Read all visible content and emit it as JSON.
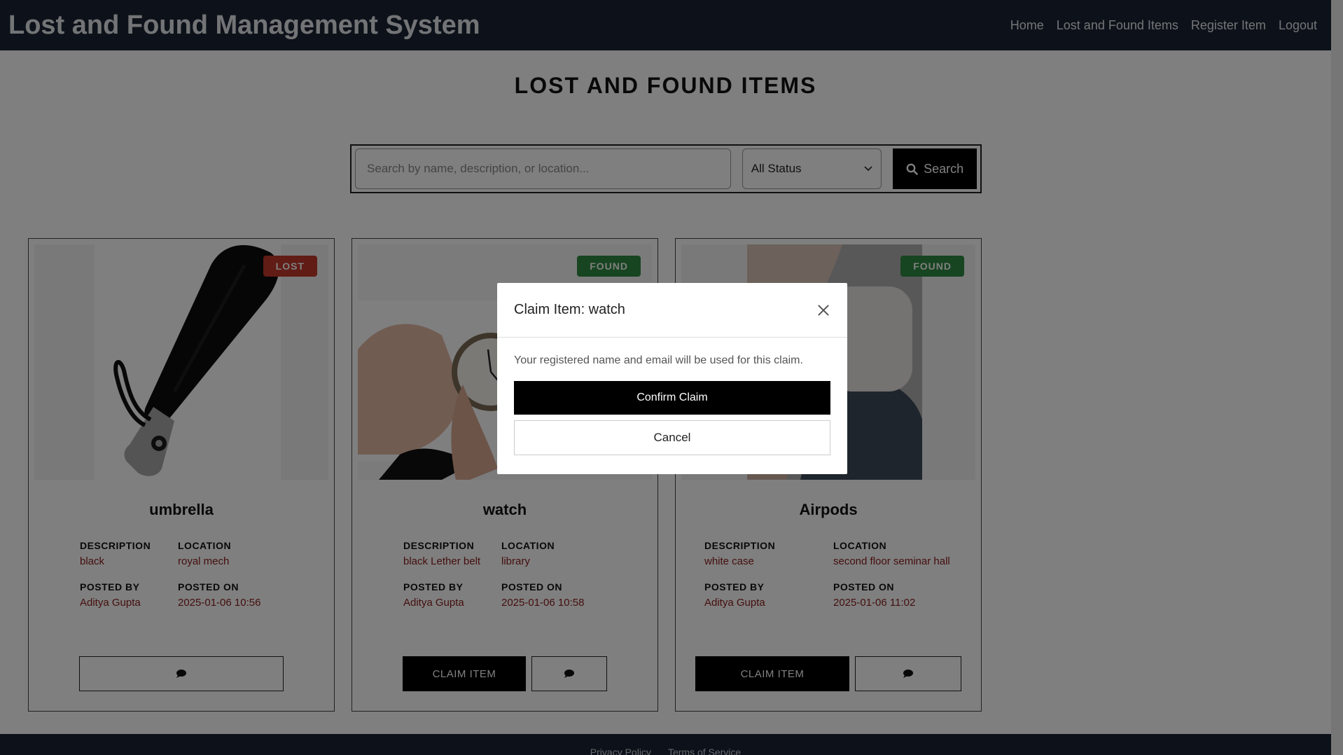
{
  "header": {
    "brand": "Lost and Found Management System",
    "nav": [
      "Home",
      "Lost and Found Items",
      "Register Item",
      "Logout"
    ]
  },
  "main": {
    "title": "LOST AND FOUND ITEMS",
    "search": {
      "placeholder": "Search by name, description, or location...",
      "value": "",
      "status_selected": "All Status",
      "button_label": "Search"
    },
    "items": [
      {
        "name": "umbrella",
        "status": "LOST",
        "description_label": "DESCRIPTION",
        "description": "black",
        "location_label": "LOCATION",
        "location": "royal mech",
        "posted_by_label": "POSTED BY",
        "posted_by": "Aditya Gupta",
        "posted_on_label": "POSTED ON",
        "posted_on": "2025-01-06 10:56"
      },
      {
        "name": "watch",
        "status": "FOUND",
        "description_label": "DESCRIPTION",
        "description": "black Lether belt",
        "location_label": "LOCATION",
        "location": "library",
        "posted_by_label": "POSTED BY",
        "posted_by": "Aditya Gupta",
        "posted_on_label": "POSTED ON",
        "posted_on": "2025-01-06 10:58",
        "claim_label": "CLAIM ITEM"
      },
      {
        "name": "Airpods",
        "status": "FOUND",
        "description_label": "DESCRIPTION",
        "description": "white case",
        "location_label": "LOCATION",
        "location": "second floor seminar hall",
        "posted_by_label": "POSTED BY",
        "posted_by": "Aditya Gupta",
        "posted_on_label": "POSTED ON",
        "posted_on": "2025-01-06 11:02",
        "claim_label": "CLAIM ITEM"
      }
    ]
  },
  "footer": {
    "links": [
      "Privacy Policy",
      "Terms of Service"
    ]
  },
  "modal": {
    "title": "Claim Item: watch",
    "text": "Your registered name and email will be used for this claim.",
    "confirm_label": "Confirm Claim",
    "cancel_label": "Cancel"
  },
  "colors": {
    "header_bg": "#1b2535",
    "lost_badge": "#c0392b",
    "found_badge": "#2e8b43",
    "accent_text": "#8a1a1a"
  },
  "icons": {
    "search": "search-icon",
    "chat": "chat-icon",
    "close": "close-icon",
    "chevron": "chevron-down-icon"
  }
}
